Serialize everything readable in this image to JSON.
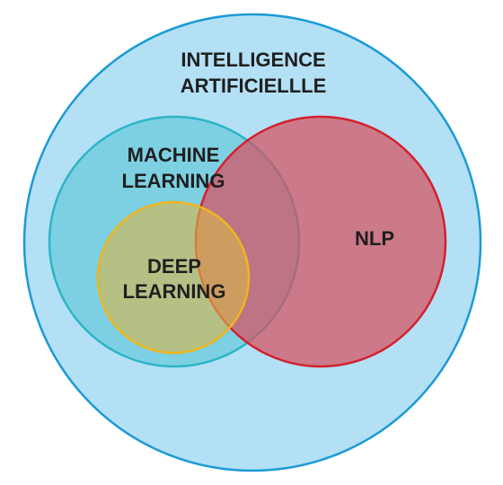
{
  "diagram": {
    "outer": {
      "line1": "INTELLIGENCE",
      "line2": "ARTIFICIELLLE",
      "fill": "#b3e0f5",
      "stroke": "#1b9ad6"
    },
    "machine_learning": {
      "line1": "MACHINE",
      "line2": "LEARNING",
      "fill": "#5cc6d6",
      "stroke": "#2bb5c6"
    },
    "nlp": {
      "label": "NLP",
      "fill": "#d55060",
      "stroke": "#d4202e"
    },
    "deep_learning": {
      "line1": "DEEP",
      "line2": "LEARNING",
      "fill": "#d6b74a",
      "stroke": "#f0b51c"
    }
  }
}
